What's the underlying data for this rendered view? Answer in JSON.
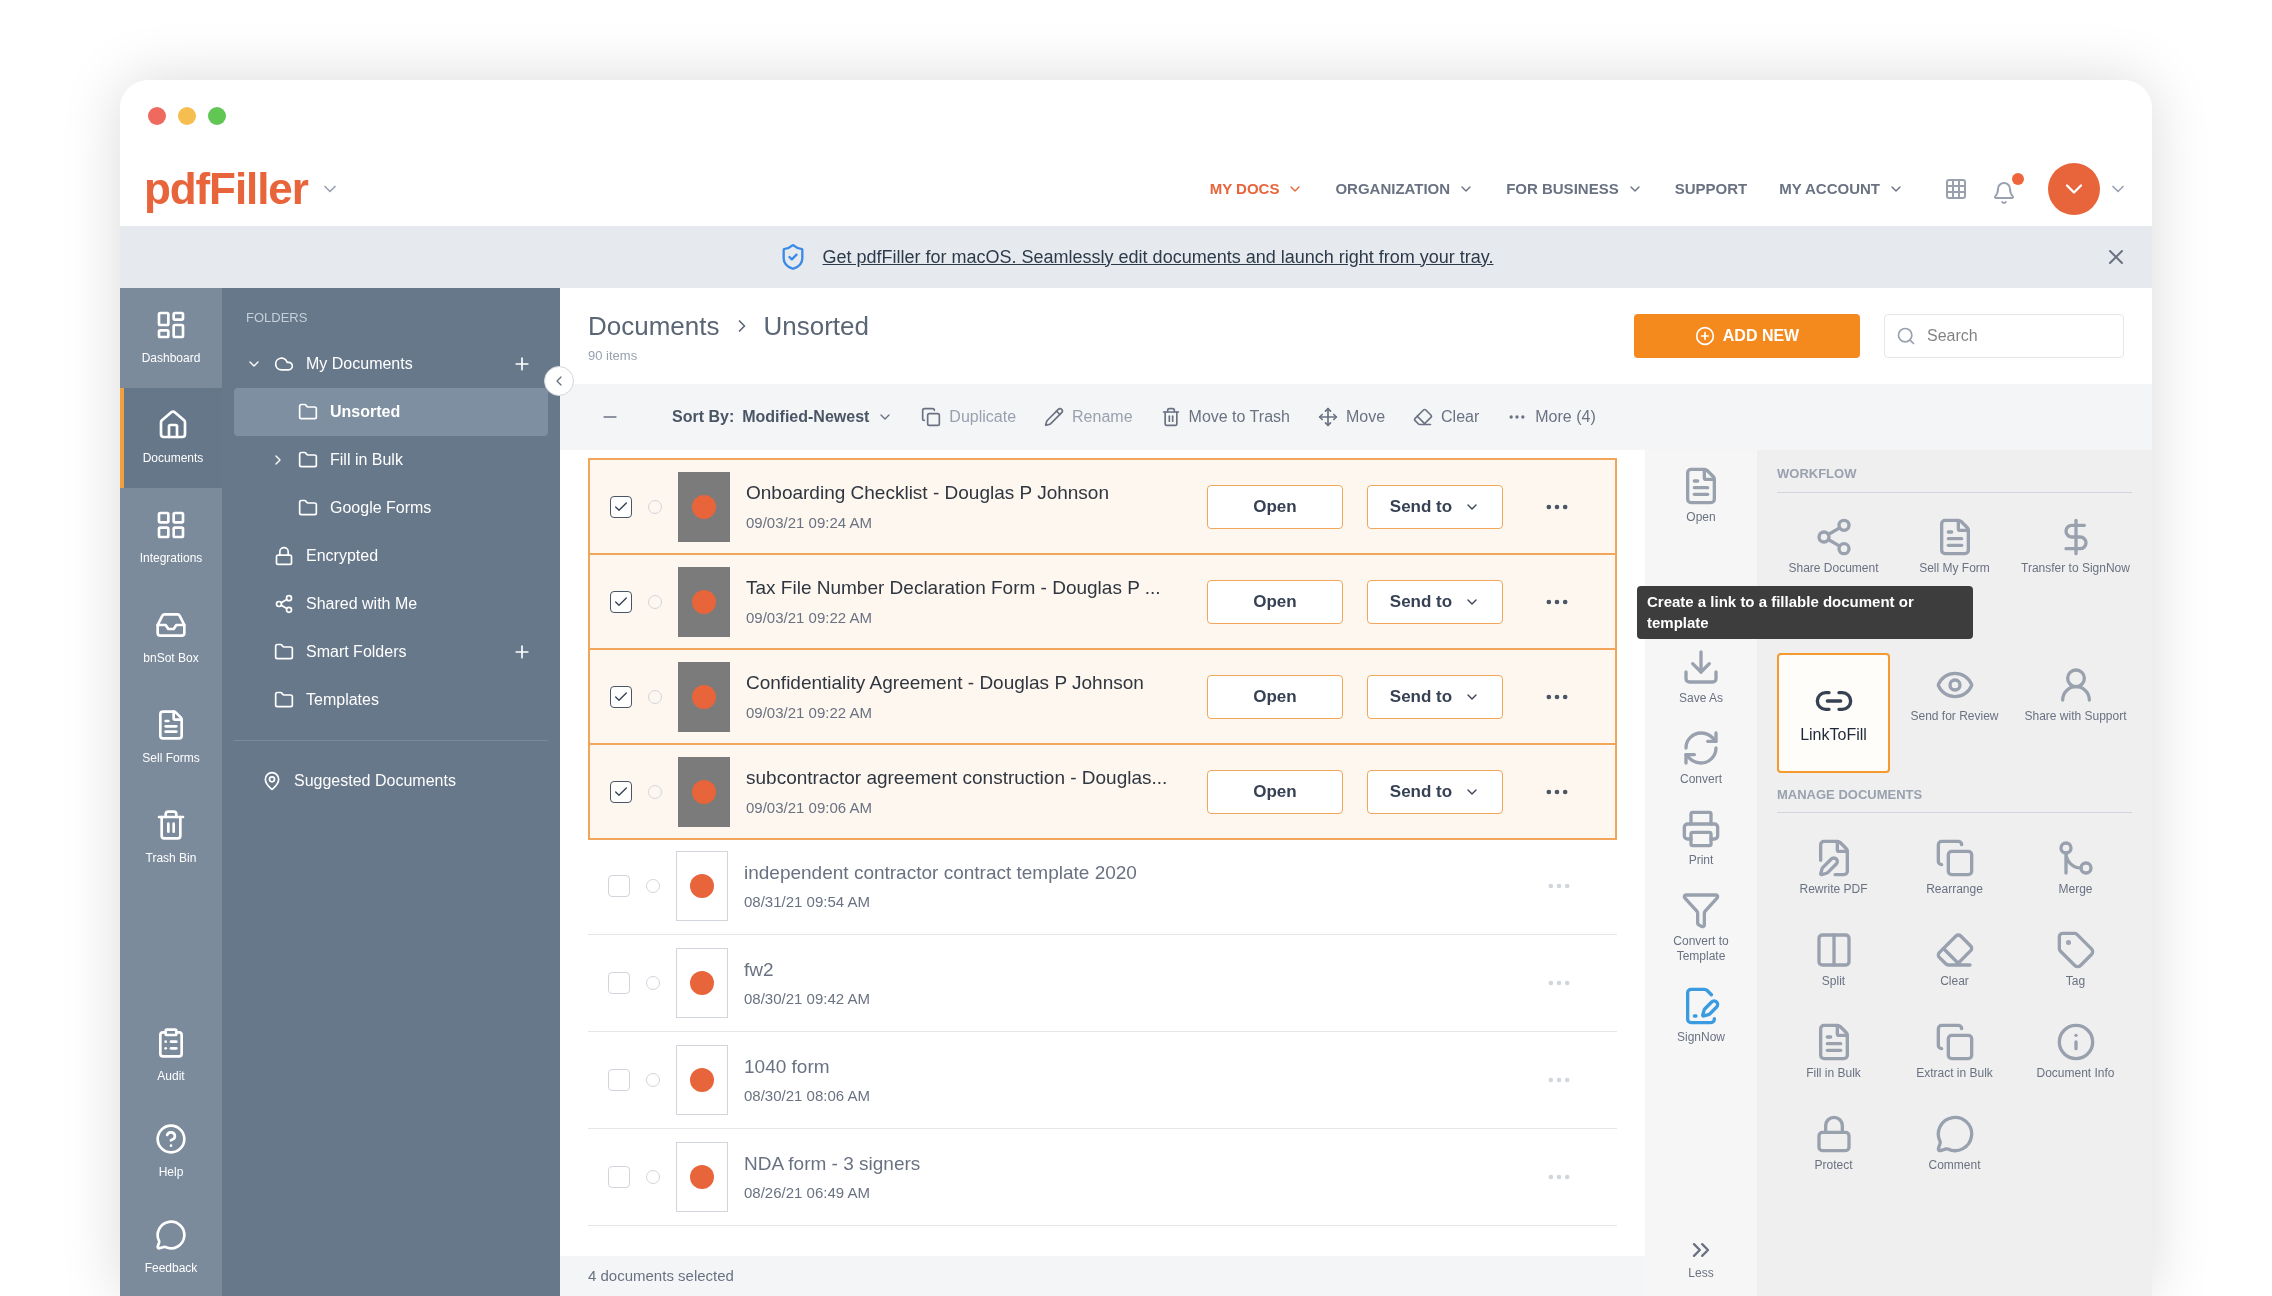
{
  "header": {
    "logo": "pdfFiller",
    "nav": [
      {
        "label": "MY DOCS",
        "selected": true
      },
      {
        "label": "ORGANIZATION",
        "selected": false
      },
      {
        "label": "FOR BUSINESS",
        "selected": false
      },
      {
        "label": "SUPPORT",
        "selected": false
      },
      {
        "label": "MY ACCOUNT",
        "selected": false
      }
    ]
  },
  "banner": {
    "text": "Get pdfFiller for macOS. Seamlessly edit documents and launch right from your tray."
  },
  "rail": [
    {
      "label": "Dashboard",
      "selected": false
    },
    {
      "label": "Documents",
      "selected": true
    },
    {
      "label": "Integrations",
      "selected": false
    },
    {
      "label": "bnSot Box",
      "selected": false
    },
    {
      "label": "Sell Forms",
      "selected": false
    },
    {
      "label": "Trash Bin",
      "selected": false
    }
  ],
  "rail_bottom": [
    {
      "label": "Audit"
    },
    {
      "label": "Help"
    },
    {
      "label": "Feedback"
    }
  ],
  "folders": {
    "title": "FOLDERS",
    "items": [
      {
        "label": "My Documents",
        "kind": "cloud",
        "expanded": true,
        "add": true,
        "selected": false,
        "children": [
          {
            "label": "Unsorted",
            "kind": "folder",
            "selected": true
          },
          {
            "label": "Fill in Bulk",
            "kind": "folder",
            "selected": false,
            "expanded": false
          },
          {
            "label": "Google Forms",
            "kind": "folder",
            "selected": false
          }
        ]
      },
      {
        "label": "Encrypted",
        "kind": "lock",
        "selected": false
      },
      {
        "label": "Shared with Me",
        "kind": "share",
        "selected": false
      },
      {
        "label": "Smart Folders",
        "kind": "folder",
        "add": true,
        "selected": false
      },
      {
        "label": "Templates",
        "kind": "folder",
        "selected": false
      }
    ],
    "suggested": "Suggested Documents"
  },
  "breadcrumb": [
    "Documents",
    "Unsorted"
  ],
  "item_count": "90 items",
  "add_new": "ADD NEW",
  "search": {
    "placeholder": "Search"
  },
  "toolbar": {
    "sort_label": "Sort By:",
    "sort_value": "Modified-Newest",
    "actions": [
      "Duplicate",
      "Rename",
      "Move to Trash",
      "Move",
      "Clear",
      "More (4)"
    ]
  },
  "documents": [
    {
      "name": "Onboarding Checklist - Douglas P Johnson",
      "date": "09/03/21 09:24 AM",
      "checked": true,
      "selected": true,
      "open": "Open",
      "send": "Send to"
    },
    {
      "name": "Tax File Number Declaration Form - Douglas P ...",
      "date": "09/03/21 09:22 AM",
      "checked": true,
      "selected": true,
      "open": "Open",
      "send": "Send to"
    },
    {
      "name": "Confidentiality Agreement - Douglas P Johnson",
      "date": "09/03/21 09:22 AM",
      "checked": true,
      "selected": true,
      "open": "Open",
      "send": "Send to"
    },
    {
      "name": "subcontractor agreement construction - Douglas...",
      "date": "09/03/21 09:06 AM",
      "checked": true,
      "selected": true,
      "open": "Open",
      "send": "Send to"
    },
    {
      "name": "independent contractor contract template 2020",
      "date": "08/31/21 09:54 AM",
      "checked": false,
      "selected": false
    },
    {
      "name": "fw2",
      "date": "08/30/21 09:42 AM",
      "checked": false,
      "selected": false
    },
    {
      "name": "1040 form",
      "date": "08/30/21 08:06 AM",
      "checked": false,
      "selected": false
    },
    {
      "name": "NDA form - 3 signers",
      "date": "08/26/21 06:49 AM",
      "checked": false,
      "selected": false
    }
  ],
  "status": "4 documents selected",
  "quick_tools": [
    "Open",
    "Save As",
    "Convert",
    "Print",
    "Convert to Template",
    "SignNow"
  ],
  "less": "Less",
  "panel": [
    {
      "title": "WORKFLOW",
      "tools": [
        {
          "label": "Share Document",
          "selected": false
        },
        {
          "label": "Sell My Form",
          "selected": false
        },
        {
          "label": "Transfer to SignNow",
          "selected": false
        },
        {
          "label": "LinkToFill",
          "selected": true
        },
        {
          "label": "Send for Review",
          "selected": false
        },
        {
          "label": "Share with Support",
          "selected": false
        }
      ]
    },
    {
      "title": "MANAGE DOCUMENTS",
      "tools": [
        {
          "label": "Rewrite PDF",
          "selected": false
        },
        {
          "label": "Rearrange",
          "selected": false
        },
        {
          "label": "Merge",
          "selected": false
        },
        {
          "label": "Split",
          "selected": false
        },
        {
          "label": "Clear",
          "selected": false
        },
        {
          "label": "Tag",
          "selected": false
        },
        {
          "label": "Fill in Bulk",
          "selected": false
        },
        {
          "label": "Extract in Bulk",
          "selected": false
        },
        {
          "label": "Document Info",
          "selected": false
        },
        {
          "label": "Protect",
          "selected": false
        },
        {
          "label": "Comment",
          "selected": false
        }
      ]
    }
  ],
  "tooltip": "Create a link to a fillable document or template"
}
